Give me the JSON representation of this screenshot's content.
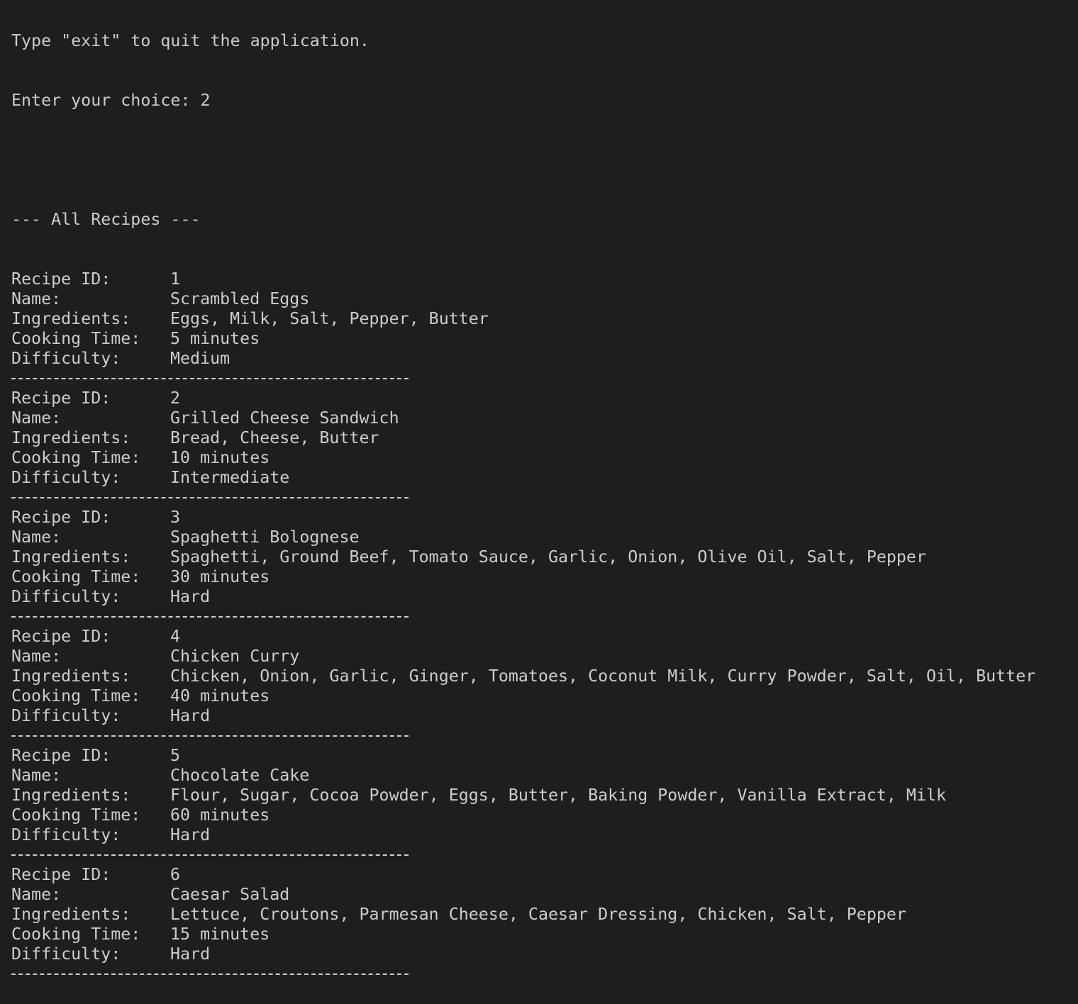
{
  "terminal": {
    "cut_line": "Type \"exit\" to quit the application.",
    "prompt_label": "Enter your choice: ",
    "prompt_value": "2",
    "section_header": "--- All Recipes ---",
    "labels": {
      "recipe_id": "Recipe ID:",
      "name": "Name:",
      "ingredients": "Ingredients:",
      "cooking_time": "Cooking Time:",
      "difficulty": "Difficulty:"
    },
    "separator": "----------------------------------------",
    "recipes": [
      {
        "id": "1",
        "name": "Scrambled Eggs",
        "ingredients": "Eggs, Milk, Salt, Pepper, Butter",
        "cooking_time": "5 minutes",
        "difficulty": "Medium"
      },
      {
        "id": "2",
        "name": "Grilled Cheese Sandwich",
        "ingredients": "Bread, Cheese, Butter",
        "cooking_time": "10 minutes",
        "difficulty": "Intermediate"
      },
      {
        "id": "3",
        "name": "Spaghetti Bolognese",
        "ingredients": "Spaghetti, Ground Beef, Tomato Sauce, Garlic, Onion, Olive Oil, Salt, Pepper",
        "cooking_time": "30 minutes",
        "difficulty": "Hard"
      },
      {
        "id": "4",
        "name": "Chicken Curry",
        "ingredients": "Chicken, Onion, Garlic, Ginger, Tomatoes, Coconut Milk, Curry Powder, Salt, Oil, Butter",
        "cooking_time": "40 minutes",
        "difficulty": "Hard"
      },
      {
        "id": "5",
        "name": "Chocolate Cake",
        "ingredients": "Flour, Sugar, Cocoa Powder, Eggs, Butter, Baking Powder, Vanilla Extract, Milk",
        "cooking_time": "60 minutes",
        "difficulty": "Hard"
      },
      {
        "id": "6",
        "name": "Caesar Salad",
        "ingredients": "Lettuce, Croutons, Parmesan Cheese, Caesar Dressing, Chicken, Salt, Pepper",
        "cooking_time": "15 minutes",
        "difficulty": "Hard"
      }
    ]
  },
  "colors": {
    "background": "#1e1e1e",
    "text": "#cccccc"
  }
}
